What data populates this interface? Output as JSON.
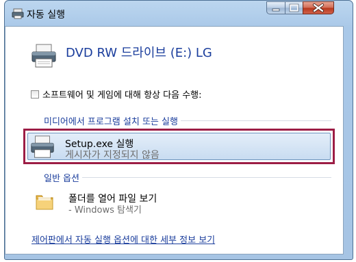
{
  "window": {
    "title": "자동 실행"
  },
  "device": {
    "title": "DVD RW 드라이브 (E:) LG"
  },
  "always_do": {
    "label": "소프트웨어 및 게임에 대해 항상 다음 수행:",
    "checked": false
  },
  "sections": {
    "media": "미디어에서 프로그램 설치 또는 실행",
    "general": "일반 옵션"
  },
  "options": {
    "setup": {
      "title": "Setup.exe 실행",
      "subtitle": "게시자가 지정되지 않음"
    },
    "open_folder": {
      "title": "폴더를 열어 파일 보기",
      "subtitle": "- Windows 탐색기"
    }
  },
  "footer": {
    "link": "제어판에서 자동 실행 옵션에 대한 세부 정보 보기"
  },
  "icons": {
    "title": "autoplay-icon",
    "device": "printer-drive-icon",
    "setup": "setup-icon",
    "folder": "folder-icon"
  },
  "colors": {
    "accent": "#1a3d9c",
    "selection_outline": "#9c1d45",
    "selection_fill": "#d2e3f5",
    "title_bar": "#a9c8e8",
    "close_button": "#c9502f"
  }
}
